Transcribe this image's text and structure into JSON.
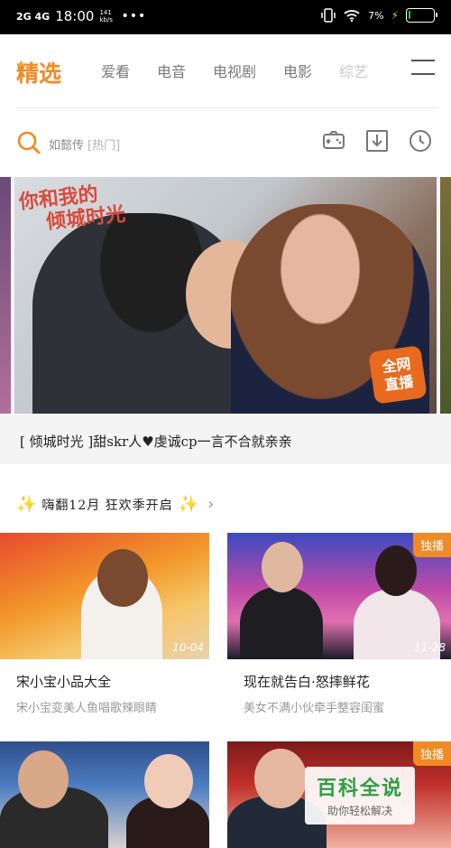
{
  "status_bar": {
    "network": "2G 4G",
    "time": "18:00",
    "speed": "141 kb/s",
    "more": "•••",
    "battery_text": "7%",
    "battery_level": 0.07
  },
  "nav": {
    "active_tab": "精选",
    "tabs": [
      "爱看",
      "电音",
      "电视剧",
      "电影",
      "综艺"
    ]
  },
  "search": {
    "placeholder": "如懿传",
    "tag": "[热门]"
  },
  "banner": {
    "title_line1": "你和我的",
    "title_line2": "倾城时光",
    "live_badge_line1": "全网",
    "live_badge_line2": "直播",
    "caption": "[ 倾城时光 ]甜skr人♥虔诚cp一言不合就亲亲"
  },
  "section": {
    "title": "嗨翻12月 狂欢季开启"
  },
  "cards": [
    {
      "title": "宋小宝小品大全",
      "subtitle": "宋小宝变美人鱼唱歌辣眼睛",
      "duration": "10-04",
      "badge": ""
    },
    {
      "title": "现在就告白·怒摔鲜花",
      "subtitle": "美女不满小伙牵手整容闺蜜",
      "duration": "11-28",
      "badge": "独播"
    },
    {
      "title": "",
      "subtitle": "",
      "duration": "",
      "badge": ""
    },
    {
      "title": "",
      "subtitle": "",
      "duration": "",
      "badge": "独播"
    }
  ],
  "watermark": {
    "main": "百科全说",
    "sub": "助你轻松解决"
  },
  "colors": {
    "accent": "#f08a24",
    "watermark": "#2e9e45"
  }
}
